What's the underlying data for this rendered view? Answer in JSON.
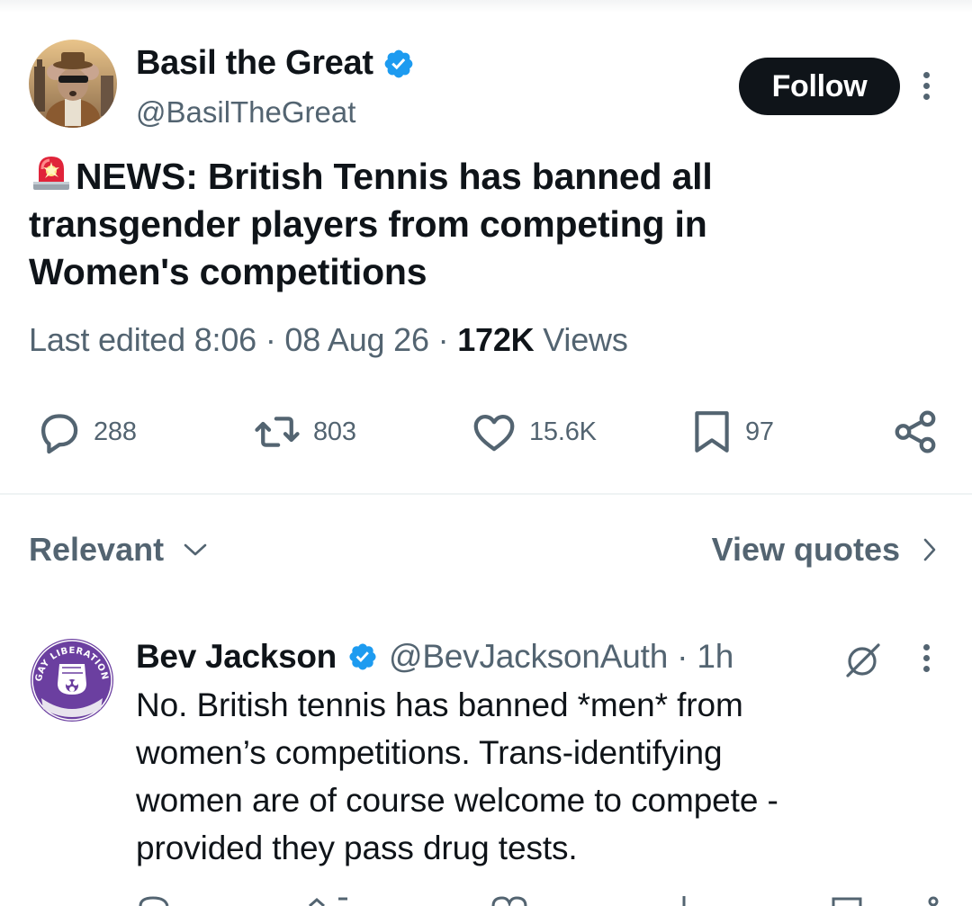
{
  "tweet": {
    "author": {
      "name": "Basil the Great",
      "handle": "@BasilTheGreat",
      "verified": true,
      "avatar": "mouse-detective-avatar"
    },
    "follow_label": "Follow",
    "text_lines": [
      "NEWS: British Tennis has banned all",
      "transgender players from competing in",
      "Women's competitions"
    ],
    "emoji": "siren-emoji",
    "meta": {
      "prefix": "Last edited 8:06",
      "sep1": " · ",
      "date": "08 Aug 26",
      "sep2": " · ",
      "views_count": "172K",
      "views_label": " Views"
    },
    "actions": {
      "replies": "288",
      "reposts": "803",
      "likes": "15.6K",
      "bookmarks": "97"
    }
  },
  "sort": {
    "label": "Relevant",
    "view_quotes": "View quotes"
  },
  "reply": {
    "author": {
      "name": "Bev Jackson",
      "handle": "@BevJacksonAuth",
      "time": "· 1h",
      "verified": true,
      "avatar": "gay-liberation-front-badge",
      "badge_text": "GAY LIBERATION FRONT"
    },
    "text_lines": [
      "No. British tennis has banned *men* from",
      "women’s competitions. Trans-identifying",
      "women are of course welcome to compete -",
      "provided they pass drug tests."
    ]
  },
  "colors": {
    "text": "#0f1419",
    "secondary": "#536471",
    "verified": "#1d9bf0",
    "divider": "#eff3f4",
    "badge_purple": "#6b3fa0"
  },
  "icons": [
    "verified-badge-icon",
    "siren-emoji",
    "more-icon",
    "reply-icon",
    "repost-icon",
    "like-icon",
    "bookmark-icon",
    "share-icon",
    "chevron-down-icon",
    "chevron-right-icon",
    "grok-icon"
  ]
}
